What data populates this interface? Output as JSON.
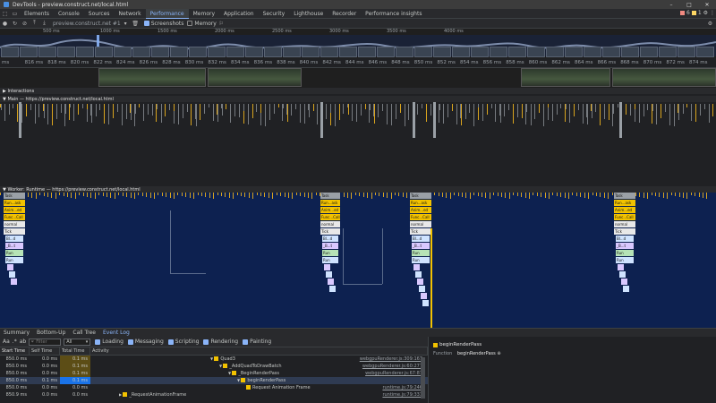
{
  "window": {
    "title": "DevTools - preview.construct.net/local.html"
  },
  "tabs": [
    "Elements",
    "Console",
    "Sources",
    "Network",
    "Performance",
    "Memory",
    "Application",
    "Security",
    "Lighthouse",
    "Recorder",
    "Performance insights"
  ],
  "active_tab": "Performance",
  "status": {
    "errors": "6",
    "warnings": "1"
  },
  "toolbar": {
    "profile": "preview.construct.net #1",
    "screenshots": "Screenshots",
    "memory": "Memory"
  },
  "overview_ticks": [
    "500 ms",
    "1000 ms",
    "1500 ms",
    "2000 ms",
    "2500 ms",
    "3000 ms",
    "3500 ms",
    "4000 ms"
  ],
  "main_ticks": [
    "ms",
    "816 ms",
    "818 ms",
    "820 ms",
    "822 ms",
    "824 ms",
    "826 ms",
    "828 ms",
    "830 ms",
    "832 ms",
    "834 ms",
    "836 ms",
    "838 ms",
    "840 ms",
    "842 ms",
    "844 ms",
    "846 ms",
    "848 ms",
    "850 ms",
    "852 ms",
    "854 ms",
    "856 ms",
    "858 ms",
    "860 ms",
    "862 ms",
    "864 ms",
    "866 ms",
    "868 ms",
    "870 ms",
    "872 ms",
    "874 ms"
  ],
  "tracks": {
    "interactions": "Interactions",
    "main": "Main — https://preview.construct.net/local.html",
    "worker": "Worker: Runtime — https://preview.construct.net/local.html"
  },
  "flame": {
    "labels": [
      "Run...ask",
      "Anim...ed",
      "Func...Call",
      "normal",
      "Tick",
      "Bl...d",
      "_B...t",
      "Run",
      "Run"
    ],
    "task": "Task"
  },
  "bottom_tabs": [
    "Summary",
    "Bottom-Up",
    "Call Tree",
    "Event Log"
  ],
  "active_bottom_tab": "Event Log",
  "filter": {
    "placeholder": "Filter",
    "dropdown": "All",
    "checks": [
      {
        "label": "Loading",
        "color": "#8ab4f8"
      },
      {
        "label": "Messaging",
        "color": "#8ab4f8"
      },
      {
        "label": "Scripting",
        "color": "#8ab4f8"
      },
      {
        "label": "Rendering",
        "color": "#8ab4f8"
      },
      {
        "label": "Painting",
        "color": "#8ab4f8"
      }
    ]
  },
  "table": {
    "headers": [
      "Start Time",
      "Self Time",
      "Total Time",
      "Activity"
    ],
    "rows": [
      {
        "start": "850.0 ms",
        "self": "0.0 ms",
        "total": "0.1 ms",
        "activity": "Quad3",
        "link": "webgpuRenderer.js:309:167",
        "indent": 2,
        "arrow": "▼"
      },
      {
        "start": "850.0 ms",
        "self": "0.0 ms",
        "total": "0.1 ms",
        "activity": "_AddQuadToDrawBatch",
        "link": "webgpuRenderer.js:60:277",
        "indent": 3,
        "arrow": "▼"
      },
      {
        "start": "850.0 ms",
        "self": "0.0 ms",
        "total": "0.1 ms",
        "activity": "_BeginRenderPass",
        "link": "webgpuRenderer.js:67:87",
        "indent": 4,
        "arrow": "▼"
      },
      {
        "start": "850.0 ms",
        "self": "0.1 ms",
        "total": "0.1 ms",
        "activity": "beginRenderPass",
        "link": "",
        "indent": 5,
        "arrow": "▼"
      },
      {
        "start": "850.0 ms",
        "self": "0.0 ms",
        "total": "0.0 ms",
        "activity": "Request Animation Frame",
        "link": "runtime.js:79:246",
        "indent": 6,
        "arrow": ""
      },
      {
        "start": "850.9 ms",
        "self": "0.0 ms",
        "total": "0.0 ms",
        "activity": "_RequestAnimationFrame",
        "link": "runtime.js:79:331",
        "indent": 0,
        "arrow": "▶"
      }
    ]
  },
  "details": {
    "title": "beginRenderPass",
    "function_label": "Function",
    "function_value": "beginRenderPass"
  },
  "colors": {
    "accent": "#8ab4f8",
    "scripting": "#f2c200",
    "worker_bg": "#0d2150"
  }
}
